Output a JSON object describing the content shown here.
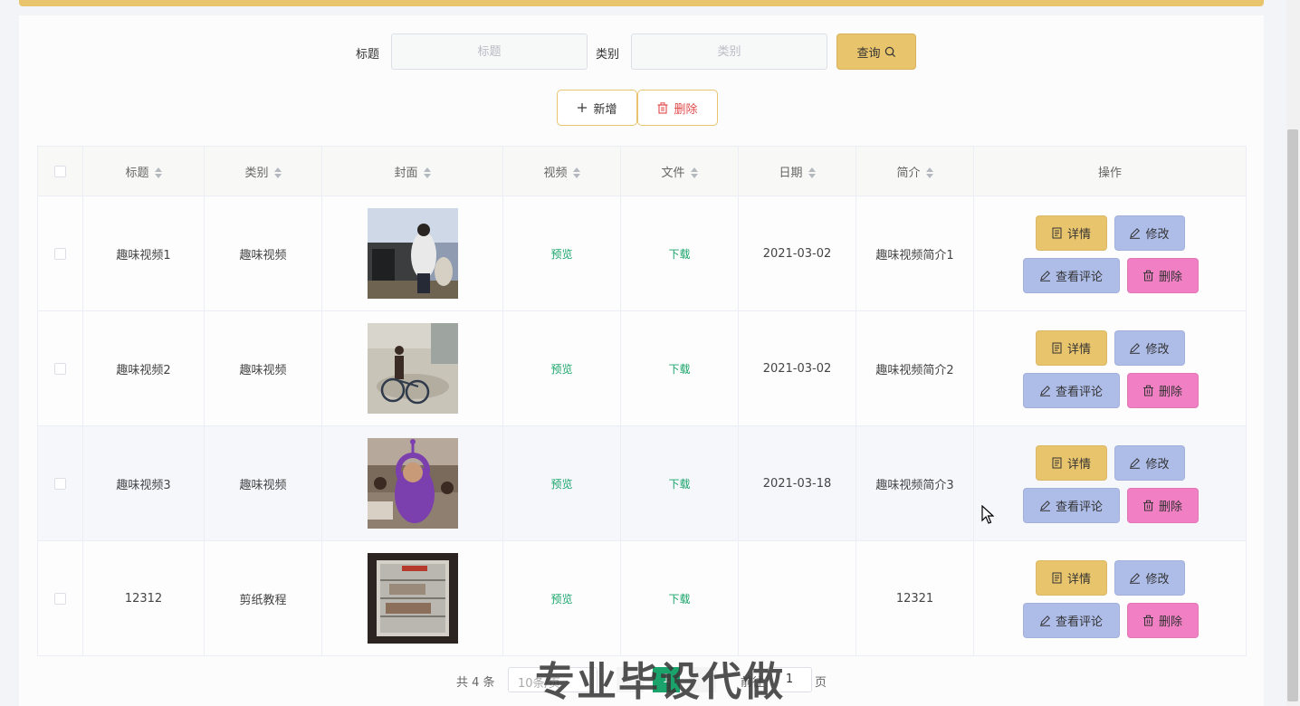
{
  "search": {
    "title_label": "标题",
    "title_placeholder": "标题",
    "category_label": "类别",
    "category_placeholder": "类别",
    "query_button": "查询"
  },
  "actions": {
    "add_label": "新增",
    "delete_label": "删除"
  },
  "table": {
    "columns": [
      "标题",
      "类别",
      "封面",
      "视频",
      "文件",
      "日期",
      "简介",
      "操作"
    ],
    "rows": [
      {
        "title": "趣味视频1",
        "category": "趣味视频",
        "video": "预览",
        "file": "下载",
        "date": "2021-03-02",
        "intro": "趣味视频简介1"
      },
      {
        "title": "趣味视频2",
        "category": "趣味视频",
        "video": "预览",
        "file": "下载",
        "date": "2021-03-02",
        "intro": "趣味视频简介2"
      },
      {
        "title": "趣味视频3",
        "category": "趣味视频",
        "video": "预览",
        "file": "下载",
        "date": "2021-03-18",
        "intro": "趣味视频简介3"
      },
      {
        "title": "12312",
        "category": "剪纸教程",
        "video": "预览",
        "file": "下载",
        "date": "",
        "intro": "12321"
      }
    ],
    "row_actions": {
      "detail": "详情",
      "edit": "修改",
      "comment": "查看评论",
      "delete": "删除"
    }
  },
  "pagination": {
    "total": "共 4 条",
    "page_size": "10条/页",
    "current_page": "1",
    "goto_label": "前往",
    "goto_value": "1",
    "goto_unit": "页"
  },
  "watermark": "专业毕设代做",
  "colors": {
    "accent": "#e8c46c",
    "lavender": "#aebce8",
    "pink": "#f17fc4",
    "green": "#1aa46b"
  }
}
